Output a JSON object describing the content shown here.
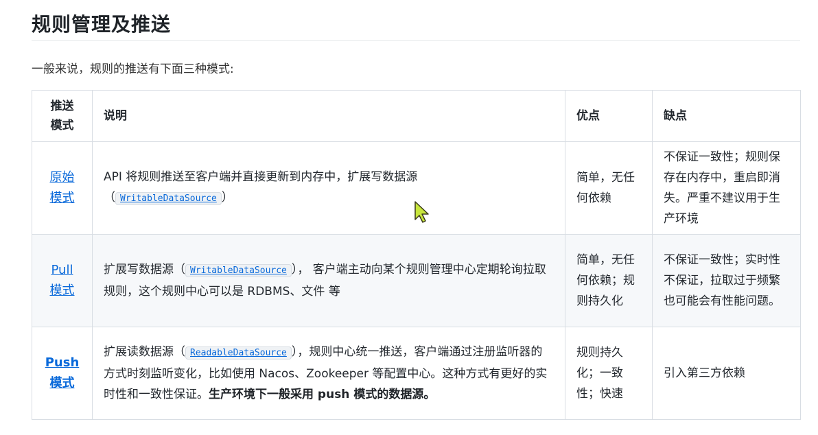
{
  "title": "规则管理及推送",
  "intro": "一般来说，规则的推送有下面三种模式:",
  "table": {
    "headers": {
      "mode_line1": "推送",
      "mode_line2": "模式",
      "description": "说明",
      "pros": "优点",
      "cons": "缺点"
    },
    "rows": [
      {
        "mode_line1": "原始",
        "mode_line2": "模式",
        "desc_text1": "API 将规则推送至客户端并直接更新到内存中，扩展写数据源",
        "desc_open": "（",
        "desc_code": "WritableDataSource",
        "desc_close": "）",
        "pros": "简单，无任何依赖",
        "cons": "不保证一致性；规则保存在内存中，重启即消失。严重不建议用于生产环境"
      },
      {
        "mode_line1": "Pull",
        "mode_line2": "模式",
        "desc_text1": "扩展写数据源（",
        "desc_code": "WritableDataSource",
        "desc_text2": "）， 客户端主动向某个规则管理中心定期轮询拉取规则，这个规则中心可以是 RDBMS、文件 等",
        "pros": "简单，无任何依赖；规则持久化",
        "cons": "不保证一致性；实时性不保证，拉取过于频繁也可能会有性能问题。"
      },
      {
        "mode_line1": "Push",
        "mode_line2": "模式",
        "desc_text1": "扩展读数据源（",
        "desc_code": "ReadableDataSource",
        "desc_text2": "），规则中心统一推送，客户端通过注册监听器的方式时刻监听变化，比如使用 Nacos、Zookeeper 等配置中心。这种方式有更好的实时性和一致性保证。",
        "desc_bold": "生产环境下一般采用 push 模式的数据源。",
        "pros": "规则持久化；一致性；快速",
        "cons": "引入第三方依赖"
      }
    ]
  },
  "colors": {
    "link": "#0969da",
    "border": "#d8dde3",
    "stripe": "#f6f8fa",
    "cursor": "#c8e63c"
  }
}
